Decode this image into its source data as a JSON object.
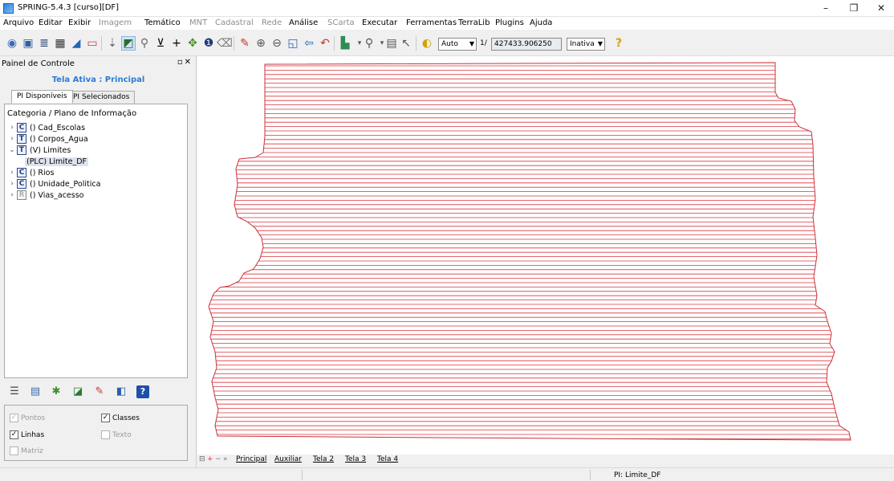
{
  "window": {
    "title": "SPRING-5.4.3 [curso][DF]",
    "minimize_glyph": "–",
    "maximize_glyph": "❐",
    "close_glyph": "✕"
  },
  "menu": [
    {
      "label": "Arquivo",
      "enabled": true
    },
    {
      "label": "Editar",
      "enabled": true
    },
    {
      "label": "Exibir",
      "enabled": true
    },
    {
      "label": "Imagem",
      "enabled": false
    },
    {
      "label": "Temático",
      "enabled": true
    },
    {
      "label": "MNT",
      "enabled": false
    },
    {
      "label": "Cadastral",
      "enabled": false
    },
    {
      "label": "Rede",
      "enabled": false
    },
    {
      "label": "Análise",
      "enabled": true
    },
    {
      "label": "SCarta",
      "enabled": false
    },
    {
      "label": "Executar",
      "enabled": true
    },
    {
      "label": "Ferramentas",
      "enabled": true
    },
    {
      "label": "TerraLib",
      "enabled": true
    },
    {
      "label": "Plugins",
      "enabled": true
    },
    {
      "label": "Ajuda",
      "enabled": true
    }
  ],
  "toolbar": {
    "zoom_mode": "Auto",
    "scale_prefix": "1/",
    "scale_value": "427433.906250",
    "state": "Inativa",
    "help_glyph": "?"
  },
  "panel": {
    "title": "Painel de Controle",
    "active_screen": "Tela Ativa : Principal",
    "tabs": [
      "PI Disponíveis",
      "PI Selecionados"
    ],
    "tree_header": "Categoria / Plano de Informação",
    "tree": [
      {
        "expander": ">",
        "icon": "C",
        "label": "() Cad_Escolas"
      },
      {
        "expander": ">",
        "icon": "T",
        "label": "() Corpos_Agua"
      },
      {
        "expander": "v",
        "icon": "T",
        "label": "(V) Limites"
      },
      {
        "expander": "",
        "icon": "",
        "label": "(PLC) Limite_DF"
      },
      {
        "expander": ">",
        "icon": "C",
        "label": "() Rios"
      },
      {
        "expander": ">",
        "icon": "C",
        "label": "() Unidade_Politica"
      },
      {
        "expander": ">",
        "icon": "R",
        "label": "() Vias_acesso"
      }
    ],
    "checkboxes": {
      "pontos": {
        "label": "Pontos",
        "checked": true,
        "enabled": false
      },
      "classes": {
        "label": "Classes",
        "checked": true,
        "enabled": true
      },
      "linhas": {
        "label": "Linhas",
        "checked": true,
        "enabled": true
      },
      "texto": {
        "label": "Texto",
        "checked": false,
        "enabled": false
      },
      "matriz": {
        "label": "Matriz",
        "checked": false,
        "enabled": false
      }
    }
  },
  "canvas": {
    "hatch_color": "#d9363e",
    "boundary_color": "#c9313a"
  },
  "screen_tabs": {
    "controls": [
      "⊟",
      "+",
      "−",
      "»"
    ],
    "tabs": [
      "Principal",
      "Auxiliar",
      "Tela 2",
      "Tela 3",
      "Tela 4"
    ]
  },
  "status": {
    "pi": "PI: Limite_DF"
  }
}
